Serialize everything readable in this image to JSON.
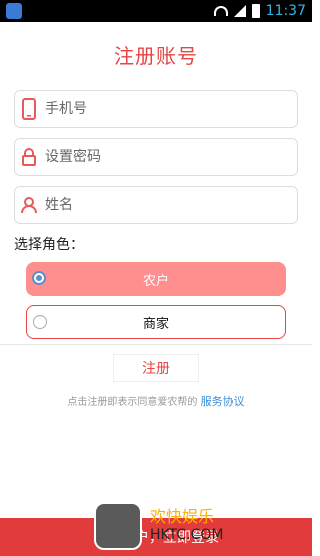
{
  "status_bar": {
    "time": "11:37",
    "icons": [
      "app-icon",
      "wifi-icon",
      "signal-icon",
      "battery-icon"
    ]
  },
  "header": {
    "title": "注册账号"
  },
  "form": {
    "phone_placeholder": "手机号",
    "password_placeholder": "设置密码",
    "name_placeholder": "姓名"
  },
  "roles": {
    "label": "选择角色：",
    "options": [
      {
        "label": "农户",
        "selected": true
      },
      {
        "label": "商家",
        "selected": false
      }
    ]
  },
  "actions": {
    "register_label": "注册"
  },
  "agreement": {
    "text": "点击注册即表示同意爱农帮的",
    "link": "服务协议"
  },
  "bottom_bar": {
    "text": "已有账户，立即登录"
  },
  "watermark": {
    "line1": "欢快娱乐",
    "line2": "HKTC.COM"
  },
  "colors": {
    "accent": "#e64545",
    "selected_role_bg": "#ff8f8f",
    "link": "#3a8fd8",
    "bottom_bar": "#e23b3b"
  }
}
